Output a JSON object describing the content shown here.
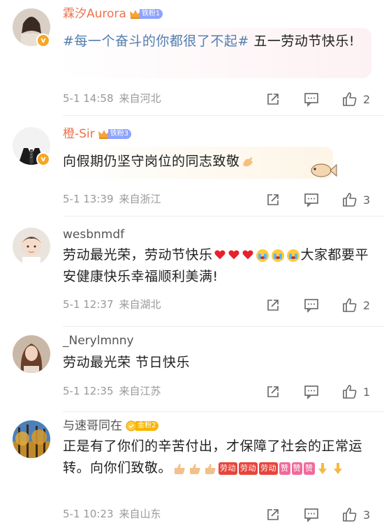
{
  "comments": [
    {
      "username": "霖汐Aurora",
      "fan_badge": "铁粉1",
      "hashtag": "#每一个奋斗的你都很了不起#",
      "text": " 五一劳动节快乐!",
      "time": "5-1 14:58",
      "location": "来自河北",
      "likes": "2"
    },
    {
      "username": "橙-Sir",
      "fan_badge": "铁粉3",
      "text": "向假期仍坚守岗位的同志致敬",
      "time": "5-1 13:39",
      "location": "来自浙江",
      "likes": "3"
    },
    {
      "username": "wesbnmdf",
      "text_a": "劳动最光荣，劳动节快乐",
      "text_b": "大家都要平安健康快乐幸福顺利美满!",
      "time": "5-1 12:37",
      "location": "来自湖北",
      "likes": "2"
    },
    {
      "username": "_Nerylmnny",
      "text": "劳动最光荣 节日快乐",
      "time": "5-1 12:35",
      "location": "来自江苏",
      "likes": "1"
    },
    {
      "username": "与速哥同在",
      "fan_badge": "金粉2",
      "text": "正是有了你们的辛苦付出，才保障了社会的正常运转。向你们致敬。",
      "inline_badge_1": "劳动",
      "inline_badge_2": "赞",
      "time": "5-1 10:23",
      "location": "来自山东",
      "likes": "3"
    }
  ],
  "colors": {
    "vip_name": "#eb7350",
    "hashtag": "#507daf",
    "meta": "#999999",
    "iron_badge": "#8ea3ff",
    "gold_badge": "#f7b500"
  }
}
